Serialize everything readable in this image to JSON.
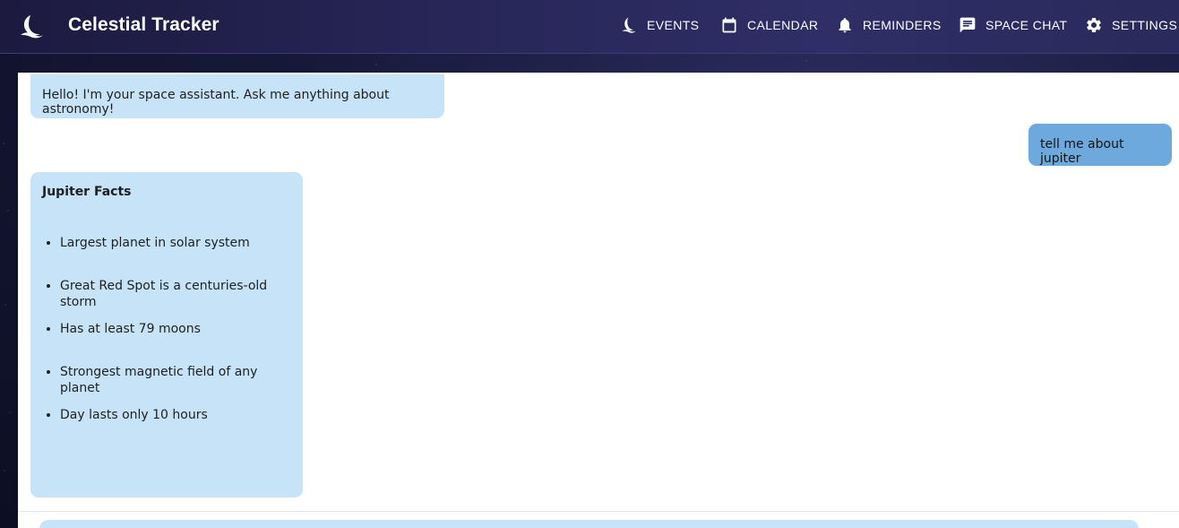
{
  "app": {
    "title": "Celestial Tracker",
    "logo_icon": "moon-icon"
  },
  "nav": {
    "items": [
      {
        "label": "EVENTS",
        "icon": "rocket-icon"
      },
      {
        "label": "CALENDAR",
        "icon": "calendar-icon"
      },
      {
        "label": "REMINDERS",
        "icon": "bell-icon"
      },
      {
        "label": "SPACE CHAT",
        "icon": "chat-icon"
      },
      {
        "label": "SETTINGS",
        "icon": "gear-icon"
      }
    ]
  },
  "chat": {
    "messages": [
      {
        "sender": "bot",
        "text": "Hello! I'm your space assistant. Ask me anything about astronomy!"
      },
      {
        "sender": "user",
        "text": "tell me about jupiter"
      },
      {
        "sender": "bot",
        "heading": "Jupiter Facts",
        "bullets": [
          "Largest planet in solar system",
          "Great Red Spot is a centuries-old storm",
          "Has at least 79 moons",
          "Strongest magnetic field of any planet",
          "Day lasts only 10 hours"
        ]
      }
    ]
  },
  "colors": {
    "bot_bubble": "#c7e3f7",
    "user_bubble": "#6da9dd",
    "header_bg": "#2a2a5c"
  }
}
